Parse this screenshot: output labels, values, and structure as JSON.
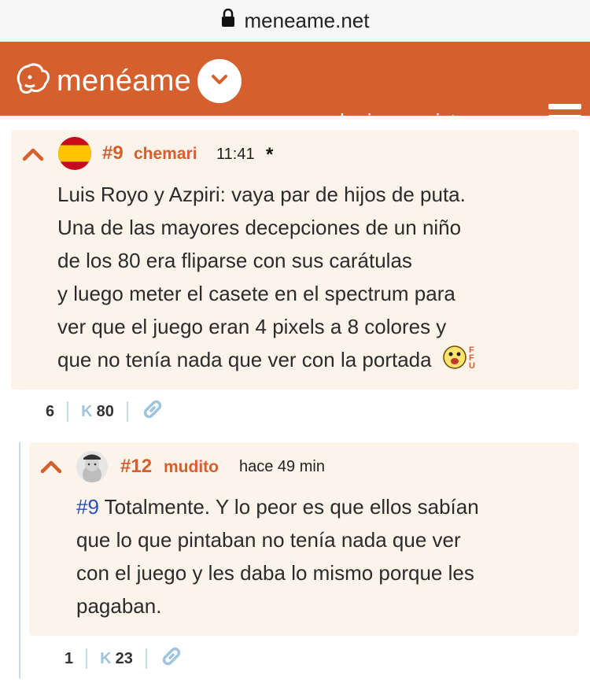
{
  "browser": {
    "url": "meneame.net"
  },
  "header": {
    "logo_text": "menéame",
    "login": "login",
    "register": "registrarse"
  },
  "colors": {
    "brand": "#d55f2d",
    "comment_bg": "#fcf3eb",
    "link": "#2a4fb5",
    "karma": "#9fc4dc"
  },
  "comments": [
    {
      "number": "#9",
      "user": "chemari",
      "time": "11:41",
      "marker": "*",
      "lines": [
        "Luis Royo y Azpiri: vaya par de hijos de puta.",
        "Una de las mayores decepciones de un niño",
        "de los 80 era fliparse con sus carátulas",
        "y luego meter el casete en el spectrum para",
        "ver que el juego eran 4 pixels a 8 colores y",
        "que no tenía nada que ver con la portada"
      ],
      "emoticon": "FFU",
      "votes": "6",
      "karma_label": "K",
      "karma": "80"
    },
    {
      "number": "#12",
      "user": "mudito",
      "time": "hace 49 min",
      "reference": "#9",
      "lines": [
        " Totalmente. Y lo peor es que ellos sabían",
        "que lo que pintaban no tenía nada que ver",
        "con el juego y les daba lo mismo porque les",
        "pagaban."
      ],
      "votes": "1",
      "karma_label": "K",
      "karma": "23"
    }
  ]
}
